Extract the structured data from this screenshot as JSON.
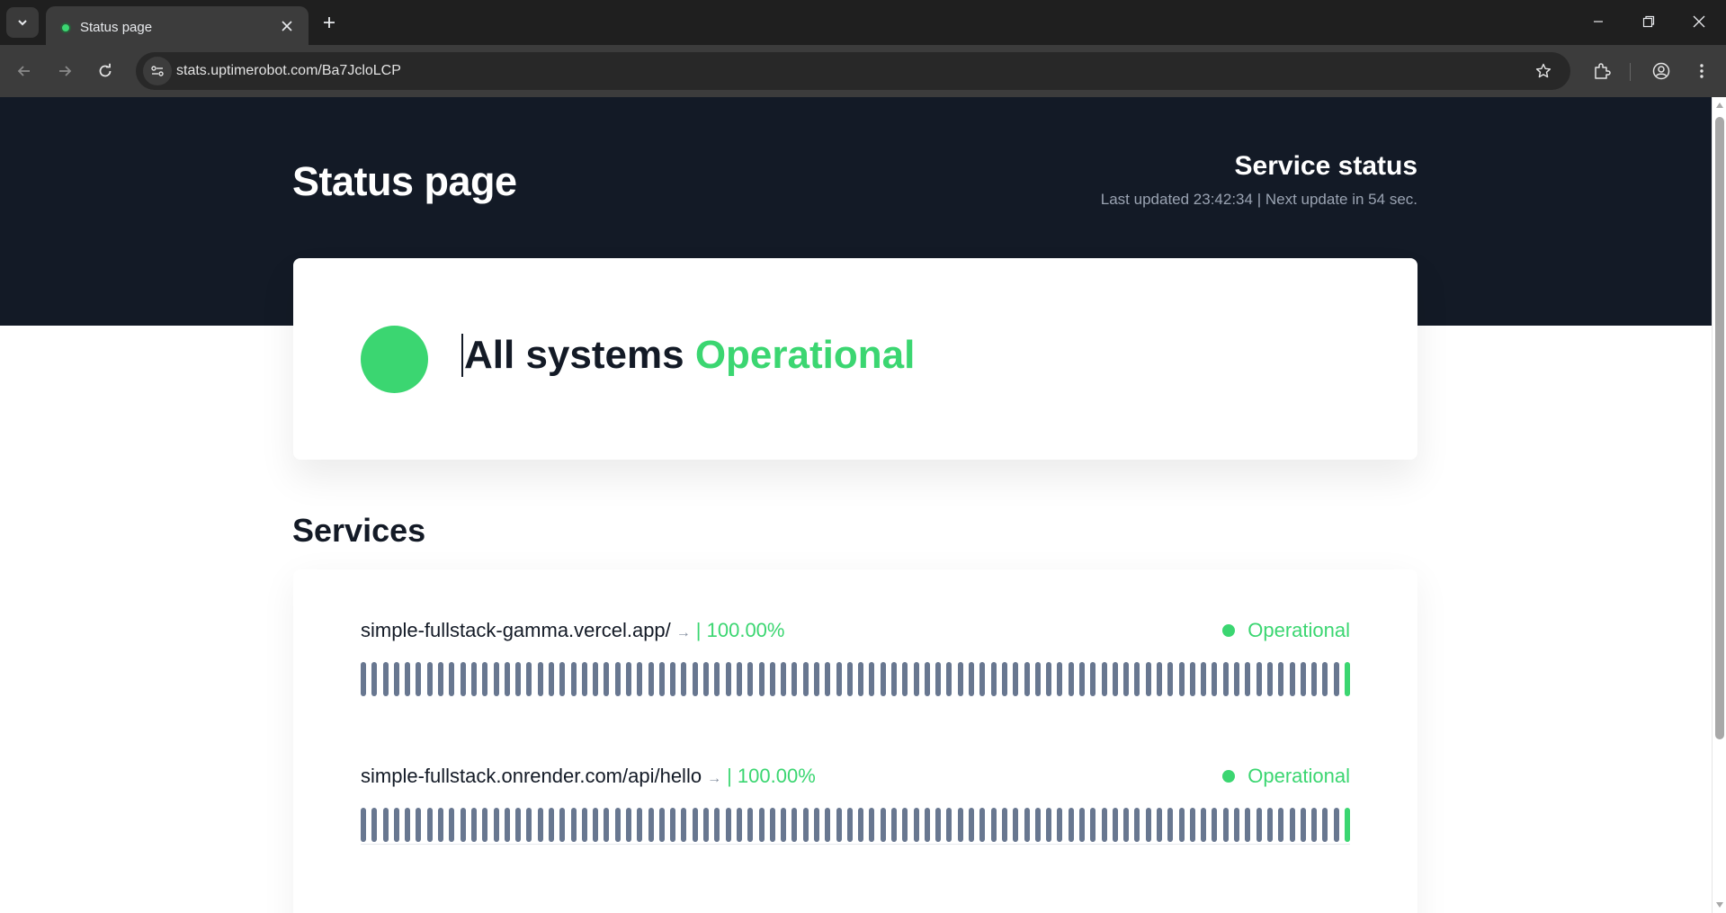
{
  "browser": {
    "tab_title": "Status page",
    "url": "stats.uptimerobot.com/Ba7JcloLCP",
    "icons": [
      "tab-list-icon",
      "close-icon",
      "plus-icon",
      "minimize-icon",
      "restore-icon",
      "close-window-icon",
      "back-icon",
      "forward-icon",
      "reload-icon",
      "site-info-icon",
      "star-icon",
      "extensions-icon",
      "profile-icon",
      "menu-dots-icon"
    ]
  },
  "header": {
    "title": "Status page",
    "service_status_title": "Service status",
    "last_updated": "Last updated 23:42:34 | Next update in 54 sec."
  },
  "summary": {
    "prefix": "All systems",
    "status": "Operational"
  },
  "services": {
    "heading": "Services",
    "items": [
      {
        "name": "simple-fullstack-gamma.vercel.app/",
        "arrow": "→",
        "separator": "|",
        "uptime": "100.00%",
        "status": "Operational"
      },
      {
        "name": "simple-fullstack.onrender.com/api/hello",
        "arrow": "→",
        "separator": "|",
        "uptime": "100.00%",
        "status": "Operational"
      }
    ]
  },
  "colors": {
    "operational": "#3bd671",
    "no_data_bar": "#687790",
    "hero_bg": "#131a26"
  }
}
